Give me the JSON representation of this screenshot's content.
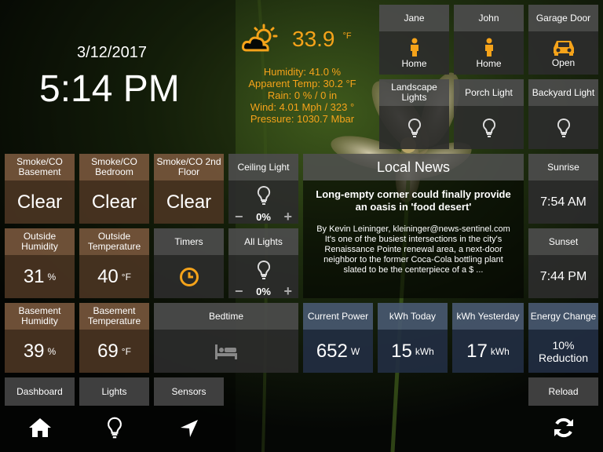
{
  "clock": {
    "date": "3/12/2017",
    "time": "5:14 PM"
  },
  "weather": {
    "icon": "partly-cloudy-icon",
    "temperature": "33.9",
    "temp_unit": "°F",
    "humidity": "Humidity: 41.0 %",
    "apparent": "Apparent Temp: 30.2 °F",
    "rain": "Rain: 0 % / 0 in",
    "wind": "Wind: 4.01 Mph / 323 °",
    "pressure": "Pressure: 1030.7 Mbar",
    "color": "#f5a31a"
  },
  "presence": [
    {
      "label": "Jane",
      "state": "Home",
      "icon": "person-icon"
    },
    {
      "label": "John",
      "state": "Home",
      "icon": "person-icon"
    },
    {
      "label": "Garage Door",
      "state": "Open",
      "icon": "car-icon"
    }
  ],
  "lights_top": [
    {
      "label": "Landscape Lights",
      "icon": "bulb-icon"
    },
    {
      "label": "Porch Light",
      "icon": "bulb-icon"
    },
    {
      "label": "Backyard Light",
      "icon": "bulb-icon"
    }
  ],
  "smoke": [
    {
      "label": "Smoke/CO Basement",
      "value": "Clear"
    },
    {
      "label": "Smoke/CO Bedroom",
      "value": "Clear"
    },
    {
      "label": "Smoke/CO 2nd Floor",
      "value": "Clear"
    }
  ],
  "ceiling": {
    "label": "Ceiling Light",
    "level": "0%",
    "minus": "−",
    "plus": "+"
  },
  "all_lights": {
    "label": "All Lights",
    "level": "0%",
    "minus": "−",
    "plus": "+"
  },
  "news": {
    "title": "Local News",
    "headline": "Long-empty corner could finally provide an oasis in 'food desert'",
    "byline": "By Kevin Leininger, kleininger@news-sentinel.com",
    "body": "It's one of the busiest intersections in the city's Renaissance Pointe renewal area, a next-door neighbor to the former Coca-Cola bottling plant slated to be the centerpiece of a $ ..."
  },
  "sunrise": {
    "label": "Sunrise",
    "value": "7:54 AM"
  },
  "sunset": {
    "label": "Sunset",
    "value": "7:44 PM"
  },
  "outside_humidity": {
    "label": "Outside Humidity",
    "value": "31",
    "unit": "%"
  },
  "outside_temp": {
    "label": "Outside Temperature",
    "value": "40",
    "unit": "°F"
  },
  "timers": {
    "label": "Timers",
    "icon": "clock-icon"
  },
  "basement_humidity": {
    "label": "Basement Humidity",
    "value": "39",
    "unit": "%"
  },
  "basement_temp": {
    "label": "Basement Temperature",
    "value": "69",
    "unit": "°F"
  },
  "bedtime": {
    "label": "Bedtime",
    "icon": "bed-icon"
  },
  "power": [
    {
      "label": "Current Power",
      "value": "652",
      "unit": "W"
    },
    {
      "label": "kWh Today",
      "value": "15",
      "unit": "kWh"
    },
    {
      "label": "kWh Yesterday",
      "value": "17",
      "unit": "kWh"
    }
  ],
  "energy_change": {
    "label": "Energy Change",
    "value_line1": "10%",
    "value_line2": "Reduction"
  },
  "nav": {
    "dashboard": "Dashboard",
    "lights": "Lights",
    "sensors": "Sensors",
    "reload": "Reload"
  },
  "bottom_icons": [
    "home-icon",
    "bulb-icon",
    "location-arrow-icon",
    "refresh-icon"
  ]
}
